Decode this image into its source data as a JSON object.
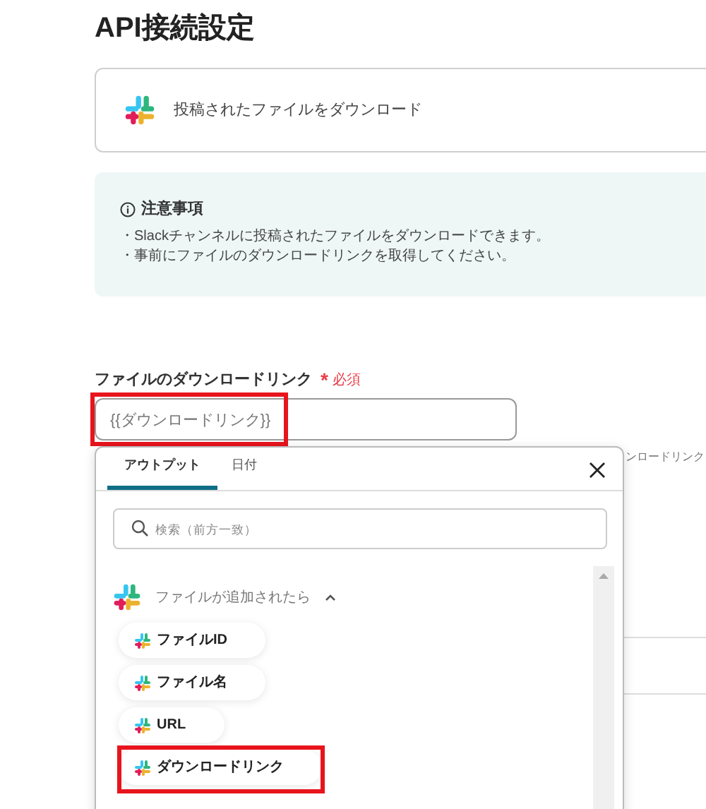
{
  "page": {
    "title": "API接続設定"
  },
  "action_card": {
    "label": "投稿されたファイルをダウンロード"
  },
  "notice": {
    "title": "注意事項",
    "lines": [
      "・Slackチャンネルに投稿されたファイルをダウンロードできます。",
      "・事前にファイルのダウンロードリンクを取得してください。"
    ]
  },
  "field": {
    "label": "ファイルのダウンロードリンク",
    "required_mark": "*",
    "required_text": "必須",
    "value": "{{ダウンロードリンク}}",
    "highlighted": true
  },
  "background_hint": "ンロードリンク",
  "popup": {
    "tabs": [
      {
        "label": "アウトプット",
        "selected": true
      },
      {
        "label": "日付",
        "selected": false
      }
    ],
    "search": {
      "placeholder": "検索（前方一致）"
    },
    "group": {
      "label": "ファイルが追加されたら",
      "expanded": true,
      "items": [
        {
          "label": "ファイルID",
          "highlighted": false
        },
        {
          "label": "ファイル名",
          "highlighted": false
        },
        {
          "label": "URL",
          "highlighted": false
        },
        {
          "label": "ダウンロードリンク",
          "highlighted": true
        }
      ]
    }
  }
}
